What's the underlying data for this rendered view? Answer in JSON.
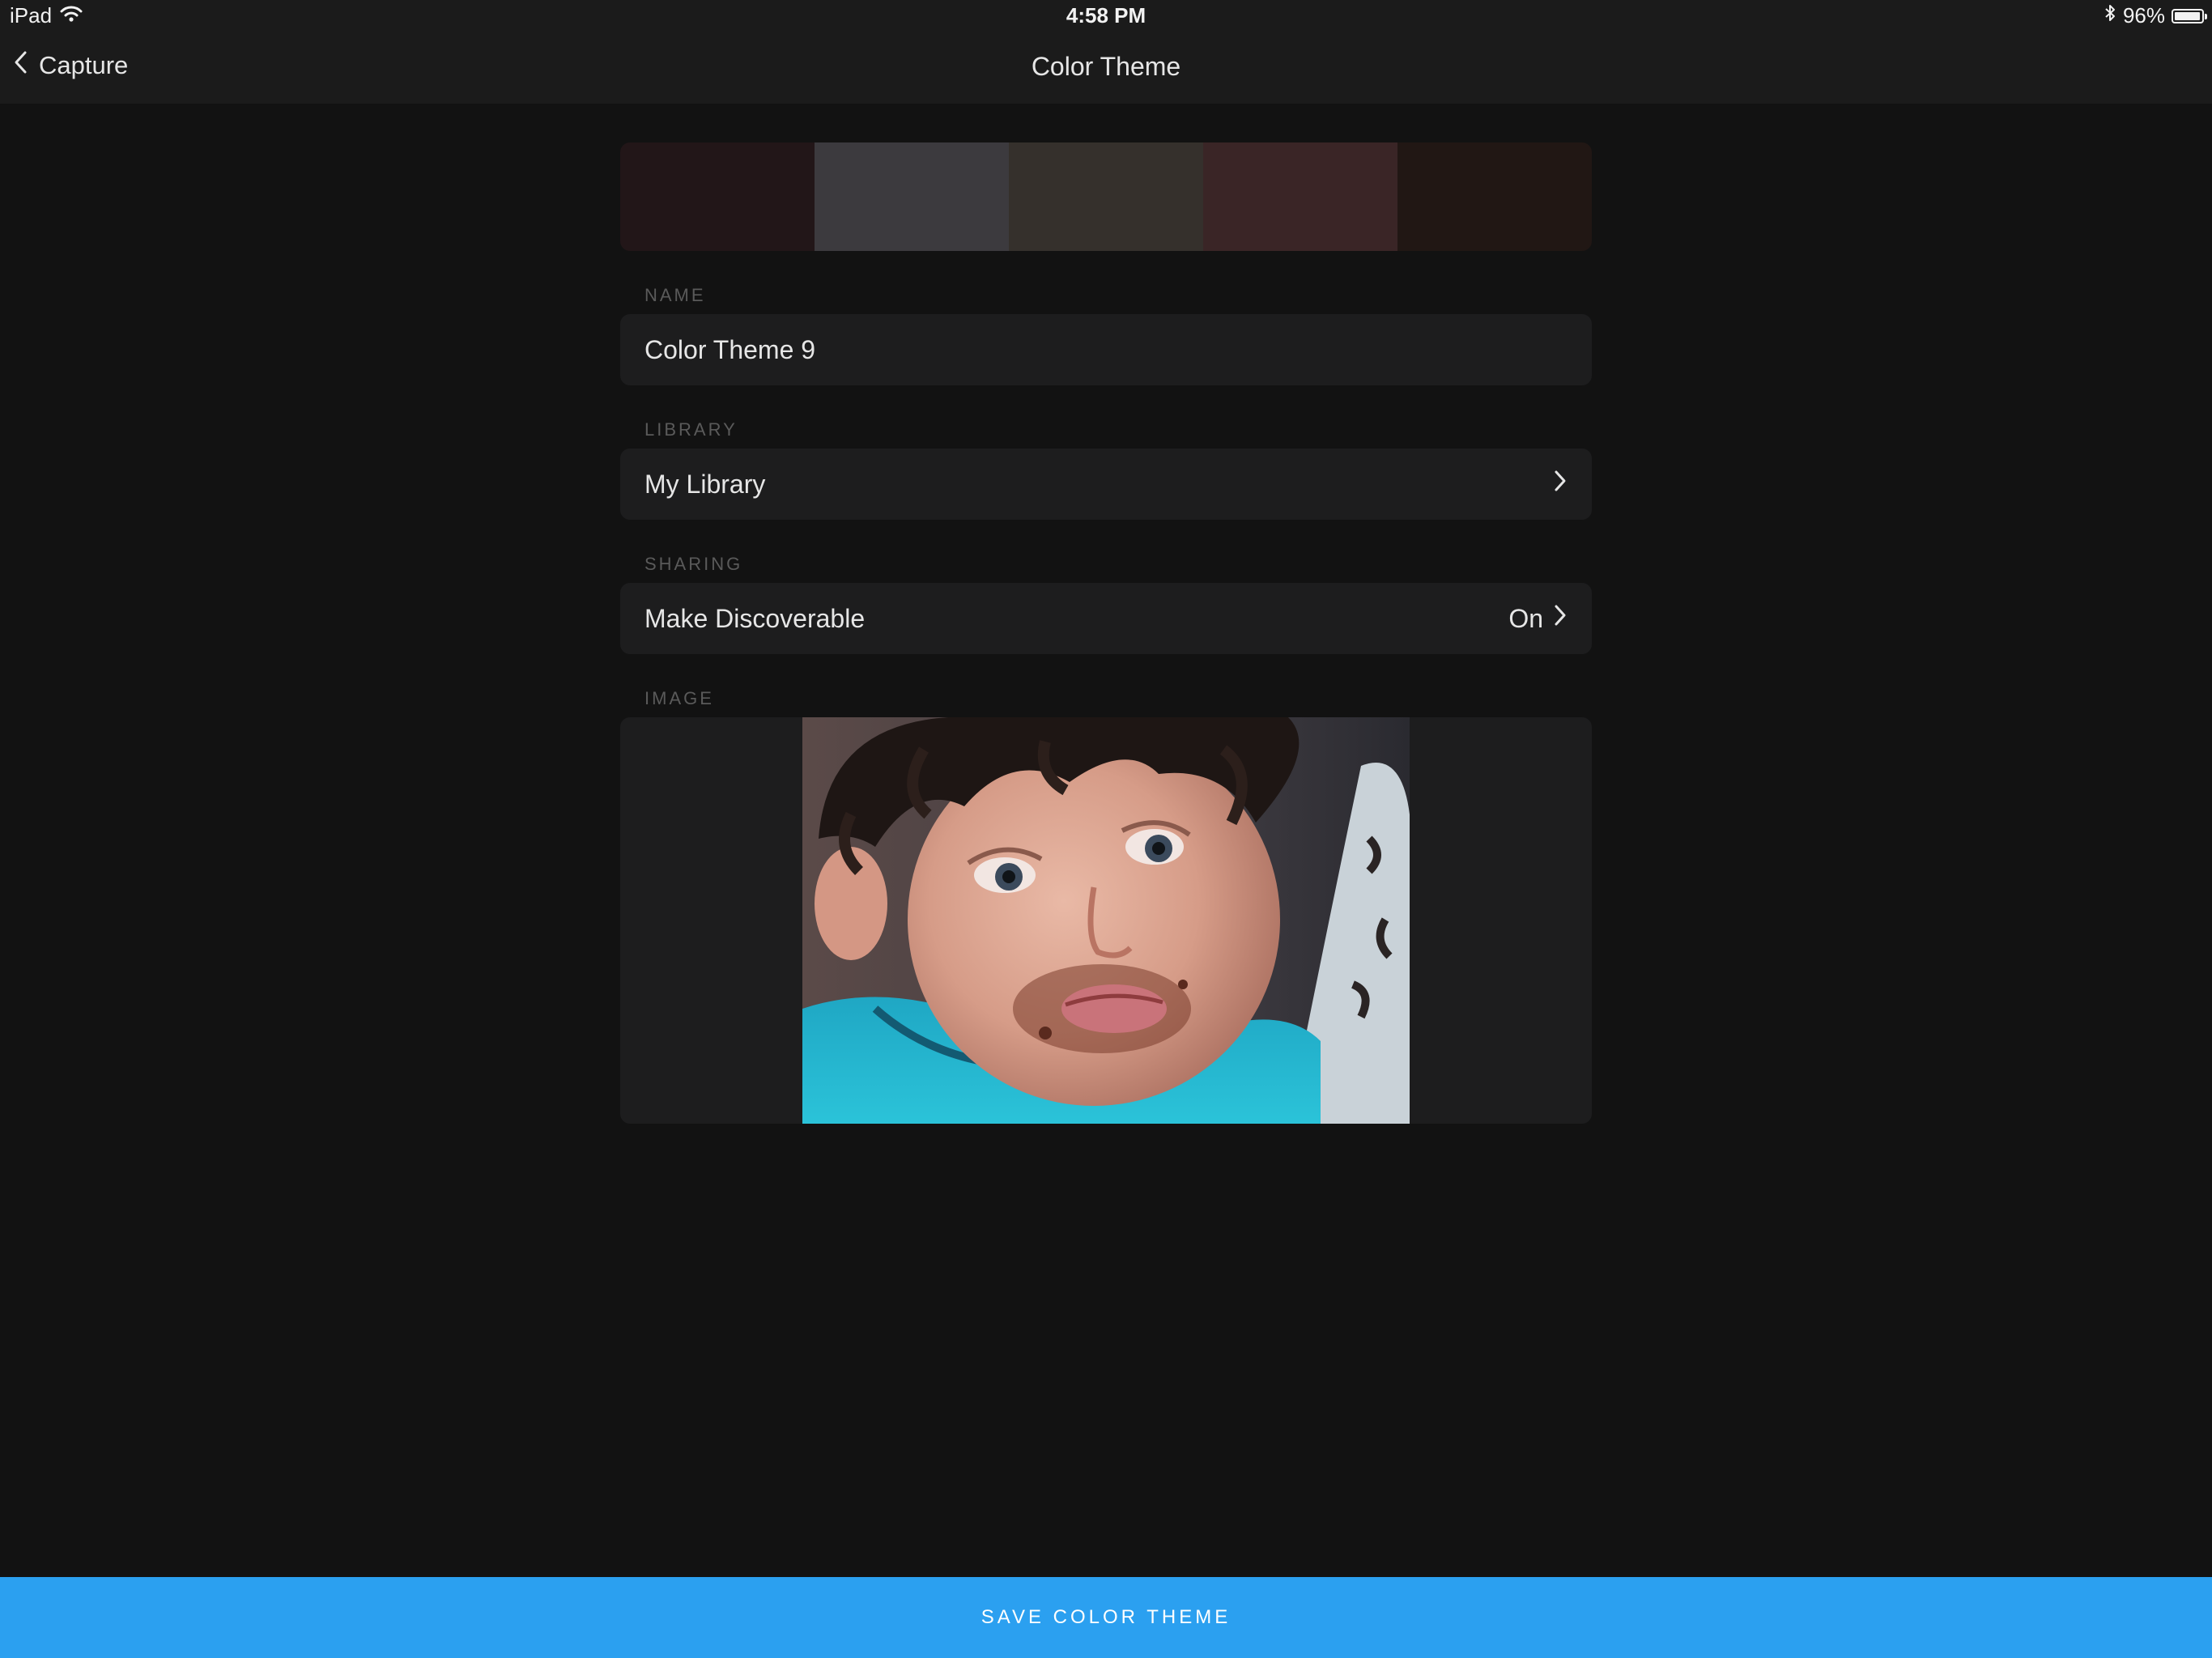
{
  "status_bar": {
    "device": "iPad",
    "time": "4:58 PM",
    "battery": "96%",
    "battery_level": 0.96,
    "icons": [
      "wifi-icon",
      "bluetooth-icon",
      "battery-icon"
    ]
  },
  "nav": {
    "back_label": "Capture",
    "title": "Color Theme"
  },
  "theme": {
    "swatches": [
      "#221618",
      "#3c3a3e",
      "#35302c",
      "#3a2526",
      "#211714"
    ]
  },
  "name_section": {
    "label": "NAME",
    "value": "Color Theme 9"
  },
  "library_section": {
    "label": "LIBRARY",
    "value": "My Library"
  },
  "sharing_section": {
    "label": "SHARING",
    "item_label": "Make Discoverable",
    "item_value": "On"
  },
  "image_section": {
    "label": "IMAGE"
  },
  "save_button": {
    "label": "SAVE COLOR THEME",
    "color": "#2ba0f0"
  }
}
